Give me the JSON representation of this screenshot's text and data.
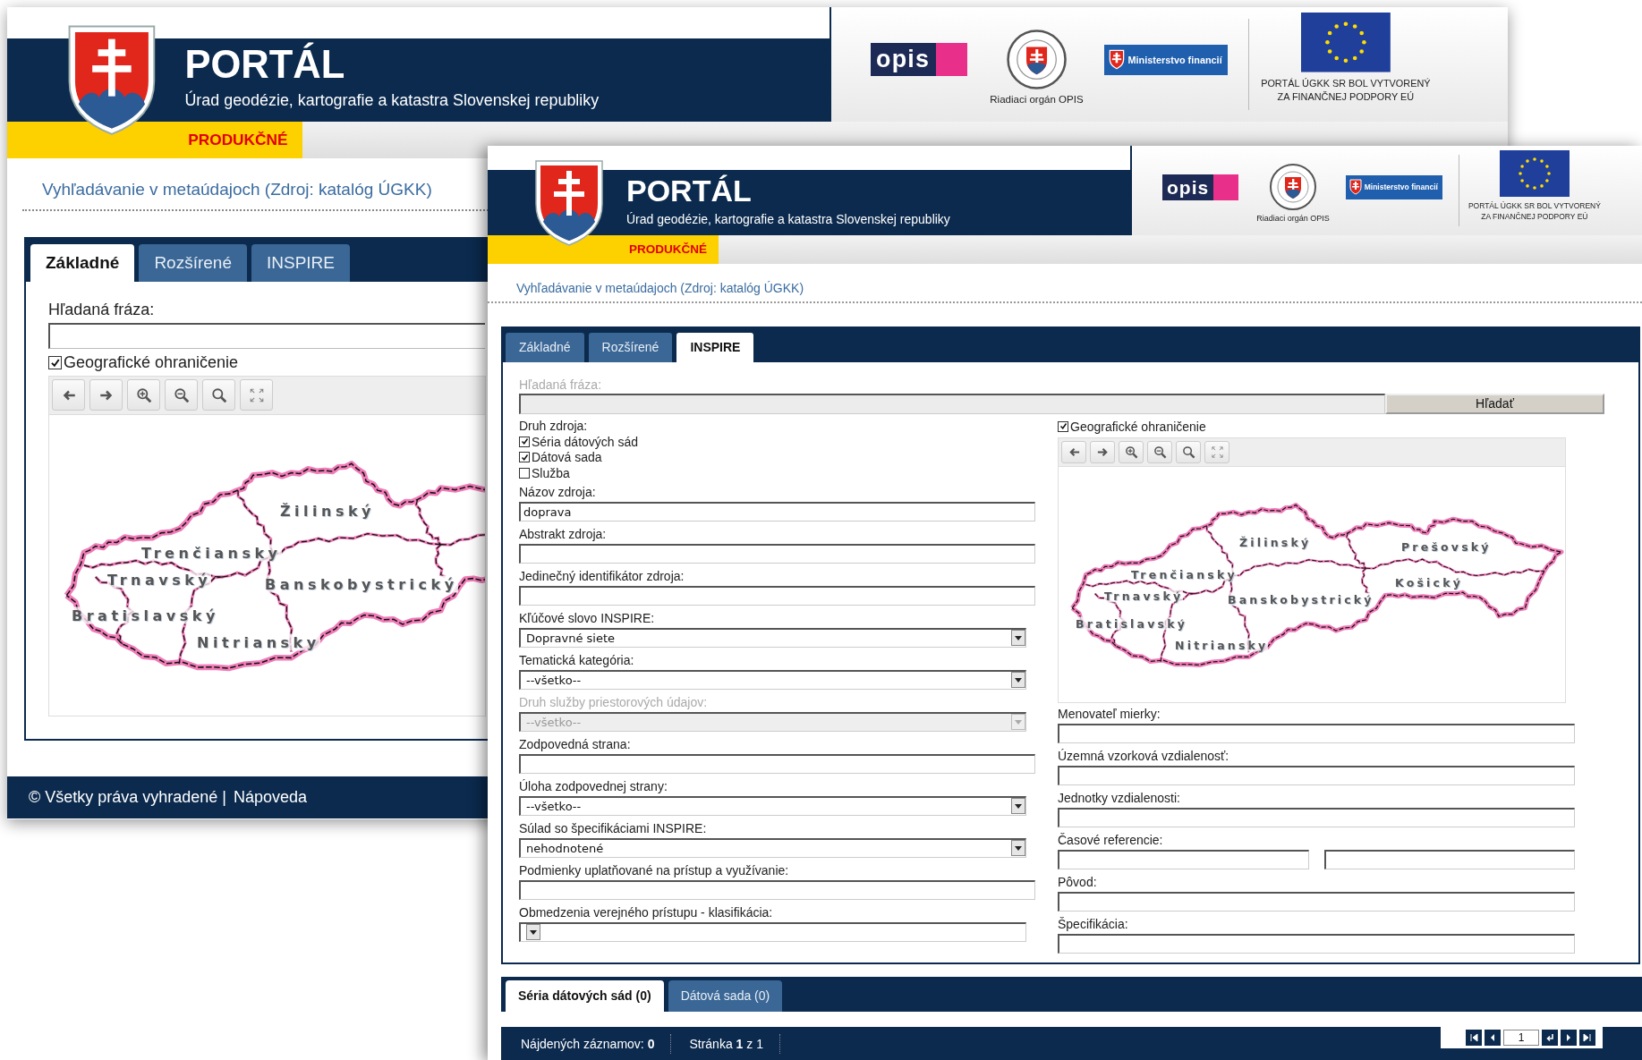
{
  "back_window": {
    "header": {
      "title": "PORTÁL",
      "subtitle": "Úrad geodézie, kartografie a katastra Slovenskej republiky",
      "environment": "PRODUKČNÉ",
      "logo_text": "opis",
      "emblem_caption": "Riadiaci orgán OPIS",
      "ministry_logo": "Ministerstvo financií",
      "eu_note": "PORTÁL ÚGKK SR BOL VYTVORENÝ\nZA FINANČNEJ PODPORY EÚ"
    },
    "breadcrumb": "Vyhľadávanie v metaúdajoch (Zdroj: katalóg ÚGKK)",
    "tabs": [
      {
        "label": "Základné",
        "selected": true
      },
      {
        "label": "Rozšírené",
        "selected": false
      },
      {
        "label": "INSPIRE",
        "selected": false
      }
    ],
    "search": {
      "label": "Hľadaná fráza:",
      "disabled": false
    },
    "geo_filter": {
      "label": "Geografické ohraničenie",
      "checked": true
    },
    "map_labels": [
      "Žilinský",
      "Trenčiansky",
      "Trnavský",
      "Banskobystrický",
      "Bratislavský",
      "Nitriansky"
    ],
    "footer": {
      "copyright": "© Všetky práva vyhradené |",
      "help_link": "Nápoveda"
    }
  },
  "front_window": {
    "header": {
      "title": "PORTÁL",
      "subtitle": "Úrad geodézie, kartografie a katastra Slovenskej republiky",
      "environment": "PRODUKČNÉ",
      "logo_text": "opis",
      "emblem_caption": "Riadiaci orgán OPIS",
      "ministry_logo": "Ministerstvo financií",
      "eu_note": "PORTÁL ÚGKK SR BOL VYTVORENÝ\nZA FINANČNEJ PODPORY EÚ"
    },
    "breadcrumb": "Vyhľadávanie v metaúdajoch (Zdroj: katalóg ÚGKK)",
    "tabs": [
      {
        "label": "Základné",
        "selected": false
      },
      {
        "label": "Rozšírené",
        "selected": false
      },
      {
        "label": "INSPIRE",
        "selected": true
      }
    ],
    "search": {
      "label": "Hľadaná fráza:",
      "disabled": true,
      "button": "Hľadať"
    },
    "left_fields": [
      {
        "kind": "checkboxes",
        "label": "Druh zdroja:",
        "disabled": false,
        "options": [
          {
            "label": "Séria dátových sád",
            "checked": true
          },
          {
            "label": "Dátová sada",
            "checked": true
          },
          {
            "label": "Služba",
            "checked": false
          }
        ]
      },
      {
        "kind": "text",
        "label": "Názov zdroja:",
        "value": "doprava",
        "disabled": false
      },
      {
        "kind": "text",
        "label": "Abstrakt zdroja:",
        "disabled": false
      },
      {
        "kind": "text",
        "label": "Jedinečný identifikátor zdroja:",
        "disabled": false
      },
      {
        "kind": "select",
        "label": "Kľúčové slovo INSPIRE:",
        "value": "Dopravné siete",
        "disabled": false
      },
      {
        "kind": "select",
        "label": "Tematická kategória:",
        "value": "--všetko--",
        "disabled": false
      },
      {
        "kind": "select",
        "label": "Druh služby priestorových údajov:",
        "value": "--všetko--",
        "disabled": true
      },
      {
        "kind": "text",
        "label": "Zodpovedná strana:",
        "disabled": false
      },
      {
        "kind": "select",
        "label": "Úloha zodpovednej strany:",
        "value": "--všetko--",
        "disabled": false
      },
      {
        "kind": "select",
        "label": "Súlad so špecifikáciami INSPIRE:",
        "value": "nehodnotené",
        "disabled": false
      },
      {
        "kind": "text",
        "label": "Podmienky uplatňované na prístup a využívanie:",
        "disabled": false
      },
      {
        "kind": "select",
        "label": "Obmedzenia verejného prístupu - klasifikácia:",
        "disabled": false
      }
    ],
    "geo_filter": {
      "label": "Geografické ohraničenie",
      "checked": true
    },
    "map_labels": [
      "Žilinský",
      "Trenčiansky",
      "Trnavský",
      "Banskobystrický",
      "Bratislavský",
      "Nitriansky",
      "Prešovský",
      "Košický"
    ],
    "right_fields": [
      {
        "kind": "text",
        "label": "Menovateľ mierky:"
      },
      {
        "kind": "text",
        "label": "Územná vzorková vzdialenosť:"
      },
      {
        "kind": "text",
        "label": "Jednotky vzdialenosti:"
      },
      {
        "kind": "date_range",
        "label": "Časové referencie:"
      },
      {
        "kind": "text",
        "label": "Pôvod:"
      },
      {
        "kind": "text",
        "label": "Špecifikácia:"
      }
    ],
    "results": {
      "tabs": [
        {
          "label": "Séria dátových sád (0)",
          "selected": true
        },
        {
          "label": "Dátová sada (0)",
          "selected": false
        }
      ],
      "found": "Nájdených záznamov: **0**",
      "page": "Stránka **1** z 1",
      "page_input": "1"
    }
  }
}
